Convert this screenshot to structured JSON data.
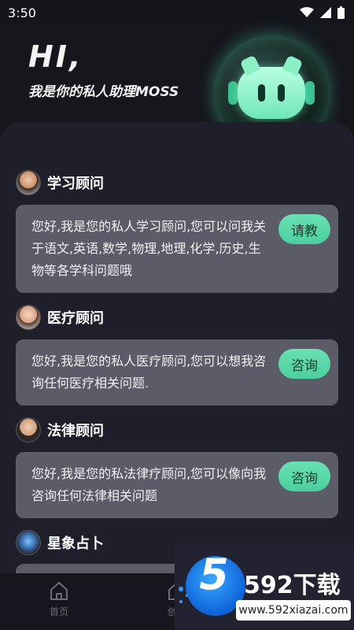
{
  "status": {
    "time": "3:50"
  },
  "hero": {
    "greeting": "HI,",
    "subtitle": "我是你的私人助理MOSS"
  },
  "sections": [
    {
      "title": "学习顾问",
      "text": "您好,我是您的私人学习顾问,您可以问我关于语文,英语,数学,物理,地理,化学,历史,生物等各学科问题哦",
      "button": "请教"
    },
    {
      "title": "医疗顾问",
      "text": "您好,我是您的私人医疗顾问,您可以想我咨询任何医疗相关问题.",
      "button": "咨询"
    },
    {
      "title": "法律顾问",
      "text": "您好,我是您的私法律疗顾问,您可以像向我咨询任何法律相关问题",
      "button": "咨询"
    },
    {
      "title": "星象占卜"
    }
  ],
  "tabbar": {
    "home": "首页",
    "create": "创作"
  },
  "watermark": {
    "number": "5",
    "title": "592下载",
    "url": "www.592xiazai.com"
  }
}
